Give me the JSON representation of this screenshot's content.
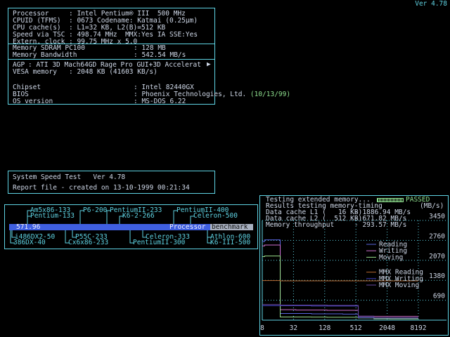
{
  "version": "Ver 4.78",
  "info": {
    "rows1": [
      {
        "label": "Processor",
        "value": "Intel Pentium® III  500 MHz"
      },
      {
        "label": "CPUID (TFMS)",
        "value": "0673 Codename: Katmai (0.25µm)"
      },
      {
        "label": "CPU cache(s)",
        "value": "L1=32 KB, L2(B)=512 KB"
      },
      {
        "label": "Speed via TSC",
        "value": "498.74 MHz  MMX:Yes IA SSE:Yes"
      },
      {
        "label": "Extern. clock",
        "value": "99.75 MHz x 5.0"
      }
    ],
    "rows2": [
      {
        "label": "Memory SDRAM PC100",
        "value": "128 MB"
      },
      {
        "label": "Memory Bandwidth",
        "value": "542.54 MB/s"
      }
    ],
    "rows3": [
      {
        "label": "AGP",
        "value": "ATI 3D Mach64GD Rage Pro GUI+3D Accelerat"
      },
      {
        "label": "VESA memory",
        "value": "2048 KB (41603 KB/s)"
      }
    ],
    "rows4": [
      {
        "label": "Chipset",
        "value": "Intel 82440GX"
      },
      {
        "label": "BIOS",
        "value": "Phoenix Technologies, Ltd.",
        "extra": "(10/13/99)"
      },
      {
        "label": "OS version",
        "value": "MS-DOS 6.22"
      }
    ]
  },
  "speed": {
    "title": "System Speed Test   Ver 4.78",
    "report": "Report file - created on 13-10-1999 00:21:34"
  },
  "bench": {
    "value": "571.96",
    "label": "Processor",
    "label2": "benchmark",
    "top_labels": [
      {
        "text": "Am5x86-133"
      },
      {
        "text": "P6-200"
      },
      {
        "text": "PentiumII-233"
      },
      {
        "text": "PentiumII-400"
      },
      {
        "text": "Pentium-133"
      },
      {
        "text": "K6-2-266"
      },
      {
        "text": "Celeron-500"
      }
    ],
    "bottom_labels": [
      {
        "text": "i486DX2-50"
      },
      {
        "text": "P55C-233"
      },
      {
        "text": "Celeron-333"
      },
      {
        "text": "Athlon-600"
      },
      {
        "text": "386DX-40"
      },
      {
        "text": "Cx6x86-233"
      },
      {
        "text": "PentiumII-300"
      },
      {
        "text": "K6-III-500"
      }
    ]
  },
  "memtest": {
    "line1": "Testing extended memory...",
    "passed": "PASSED",
    "line2": "Results testing memory-timing",
    "unit": "(MB/s)",
    "rows": [
      {
        "label": "Data cache L1 (   16 KB)",
        "value": "1886.94 MB/s"
      },
      {
        "label": "Data cache L2 (  512 KB)",
        "value": "671.82 MB/s"
      },
      {
        "label": "Memory throughput",
        "value": "293.57 MB/s"
      }
    ]
  },
  "chart_data": {
    "type": "line",
    "xlabel": "",
    "ylabel": "",
    "x": [
      8,
      16,
      32,
      64,
      128,
      256,
      512,
      1024,
      2048,
      4096,
      8192
    ],
    "x_ticks": [
      "8",
      "32",
      "128",
      "512",
      "2048",
      "8192"
    ],
    "y_ticks": [
      "3450",
      "2760",
      "2070",
      "1380",
      "690"
    ],
    "ylim": [
      0,
      3450
    ],
    "series": [
      {
        "name": "Reading",
        "color": "#5a66e0",
        "values": [
          2720,
          2780,
          230,
          230,
          220,
          220,
          210,
          80,
          70,
          70,
          70
        ]
      },
      {
        "name": "Writing",
        "color": "#d070d0",
        "values": [
          2570,
          2600,
          360,
          350,
          350,
          340,
          340,
          130,
          130,
          130,
          130
        ]
      },
      {
        "name": "Moving",
        "color": "#9ae08c",
        "values": [
          2200,
          2220,
          110,
          110,
          105,
          100,
          100,
          80,
          50,
          45,
          45
        ]
      },
      {
        "name": "MMX Reading",
        "color": "#b86a30",
        "values": [
          1370,
          1370,
          1360,
          1360,
          1360,
          1360,
          1360,
          1360,
          1360,
          1360,
          1360
        ]
      },
      {
        "name": "MMX Writing",
        "color": "#4040c0",
        "values": [
          500,
          500,
          500,
          500,
          490,
          490,
          490,
          90,
          80,
          80,
          80
        ]
      },
      {
        "name": "MMX Moving",
        "color": "#6a4aa0",
        "values": [
          540,
          540,
          520,
          520,
          520,
          510,
          510,
          140,
          80,
          80,
          80
        ]
      }
    ]
  }
}
